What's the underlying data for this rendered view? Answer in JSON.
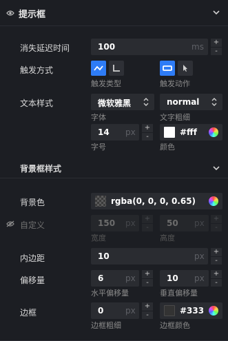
{
  "header": {
    "title": "提示框"
  },
  "delay": {
    "label": "消失延迟时间",
    "value": "100",
    "unit": "ms"
  },
  "trigger": {
    "label": "触发方式",
    "type_caption": "触发类型",
    "action_caption": "触发动作"
  },
  "text_style": {
    "label": "文本样式",
    "font": "微软雅黑",
    "font_caption": "字体",
    "weight": "normal",
    "weight_caption": "文字粗细",
    "size": "14",
    "size_unit": "px",
    "size_caption": "字号",
    "color": "#fff",
    "color_caption": "颜色"
  },
  "bg_section": {
    "title": "背景框样式"
  },
  "bg_color": {
    "label": "背景色",
    "value": "rgba(0, 0, 0, 0.65)"
  },
  "custom": {
    "label": "自定义",
    "width": "150",
    "width_unit": "px",
    "width_caption": "宽度",
    "height": "50",
    "height_unit": "px",
    "height_caption": "高度"
  },
  "padding": {
    "label": "内边距",
    "value": "10",
    "unit": "px"
  },
  "offset": {
    "label": "偏移量",
    "x": "6",
    "x_unit": "px",
    "x_caption": "水平偏移量",
    "y": "10",
    "y_unit": "px",
    "y_caption": "垂直偏移量"
  },
  "border": {
    "label": "边框",
    "width": "0",
    "width_unit": "px",
    "width_caption": "边框粗细",
    "color": "#333",
    "color_caption": "边框颜色"
  },
  "colors": {
    "accent": "#2e7cf6",
    "panel": "#1c1e23",
    "input": "#2a2c31"
  }
}
